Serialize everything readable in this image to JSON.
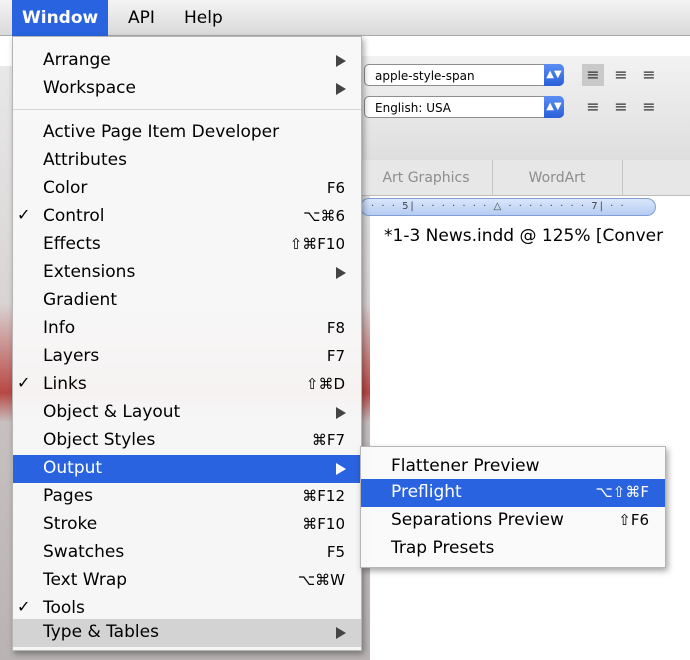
{
  "menubar": {
    "items": [
      "Window",
      "API",
      "Help"
    ]
  },
  "toolbar": {
    "font_select": "apple-style-span",
    "lang_select": "English: USA"
  },
  "tabs": [
    "Art Graphics",
    "WordArt"
  ],
  "ruler": "· · · 5| · · · · · · · △ · · · · · · · · 7| · ·",
  "document_title": "*1-3 News.indd @ 125% [Conver",
  "menu": {
    "items": [
      {
        "label": "Arrange",
        "shortcut": "",
        "submenu": true,
        "checked": false
      },
      {
        "label": "Workspace",
        "shortcut": "",
        "submenu": true,
        "checked": false
      },
      {
        "label": "Active Page Item Developer",
        "shortcut": "",
        "submenu": false,
        "checked": false
      },
      {
        "label": "Attributes",
        "shortcut": "",
        "submenu": false,
        "checked": false
      },
      {
        "label": "Color",
        "shortcut": "F6",
        "submenu": false,
        "checked": false
      },
      {
        "label": "Control",
        "shortcut": "⌥⌘6",
        "submenu": false,
        "checked": true
      },
      {
        "label": "Effects",
        "shortcut": "⇧⌘F10",
        "submenu": false,
        "checked": false
      },
      {
        "label": "Extensions",
        "shortcut": "",
        "submenu": true,
        "checked": false
      },
      {
        "label": "Gradient",
        "shortcut": "",
        "submenu": false,
        "checked": false
      },
      {
        "label": "Info",
        "shortcut": "F8",
        "submenu": false,
        "checked": false
      },
      {
        "label": "Layers",
        "shortcut": "F7",
        "submenu": false,
        "checked": false
      },
      {
        "label": "Links",
        "shortcut": "⇧⌘D",
        "submenu": false,
        "checked": true
      },
      {
        "label": "Object & Layout",
        "shortcut": "",
        "submenu": true,
        "checked": false
      },
      {
        "label": "Object Styles",
        "shortcut": "⌘F7",
        "submenu": false,
        "checked": false
      },
      {
        "label": "Output",
        "shortcut": "",
        "submenu": true,
        "checked": false
      },
      {
        "label": "Pages",
        "shortcut": "⌘F12",
        "submenu": false,
        "checked": false
      },
      {
        "label": "Stroke",
        "shortcut": "⌘F10",
        "submenu": false,
        "checked": false
      },
      {
        "label": "Swatches",
        "shortcut": "F5",
        "submenu": false,
        "checked": false
      },
      {
        "label": "Text Wrap",
        "shortcut": "⌥⌘W",
        "submenu": false,
        "checked": false
      },
      {
        "label": "Tools",
        "shortcut": "",
        "submenu": false,
        "checked": true
      },
      {
        "label": "Type & Tables",
        "shortcut": "",
        "submenu": true,
        "checked": false
      }
    ],
    "check_glyph": "✓"
  },
  "submenu": {
    "items": [
      {
        "label": "Flattener Preview",
        "shortcut": ""
      },
      {
        "label": "Preflight",
        "shortcut": "⌥⇧⌘F"
      },
      {
        "label": "Separations Preview",
        "shortcut": "⇧F6"
      },
      {
        "label": "Trap Presets",
        "shortcut": ""
      }
    ]
  },
  "colors": {
    "highlight": "#2a63e0",
    "hover": "#d3d3d3"
  }
}
